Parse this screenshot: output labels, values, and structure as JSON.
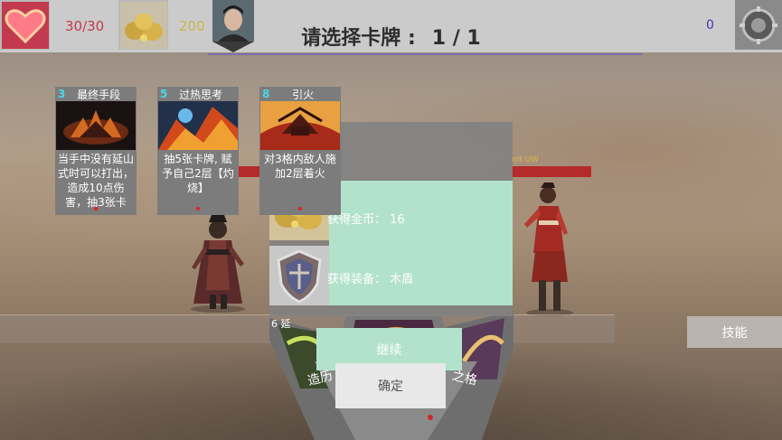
{
  "hud": {
    "hp": "30/30",
    "gold": "200",
    "title": "请选择卡牌 :",
    "progress": "1 / 1",
    "count": "0"
  },
  "cards": [
    {
      "cost": "3",
      "name": "最终手段",
      "desc": "当手中没有延山式时可以打出，造成10点伤害，抽3张卡"
    },
    {
      "cost": "5",
      "name": "过热思考",
      "desc": "抽5张卡牌, 赋予自己2层【灼烧】"
    },
    {
      "cost": "8",
      "name": "引火",
      "desc": "对3格内敌人施加2层着火"
    }
  ],
  "reward": {
    "gold_line": "获得金币： 16",
    "equip_line": "获得装备： 木盾",
    "continue_label": "继续",
    "confirm_label": "确定"
  },
  "enemy_label": "nit UW",
  "skill_label": "技能",
  "hand_fragments": [
    "造历",
    "之格",
    "6 延"
  ],
  "colors": {
    "hp": "#c03a4a",
    "gold": "#c8b74c",
    "cost": "#48d8e8",
    "reward_panel": "#b2e2cc",
    "hpbar": "#b52a2a"
  }
}
